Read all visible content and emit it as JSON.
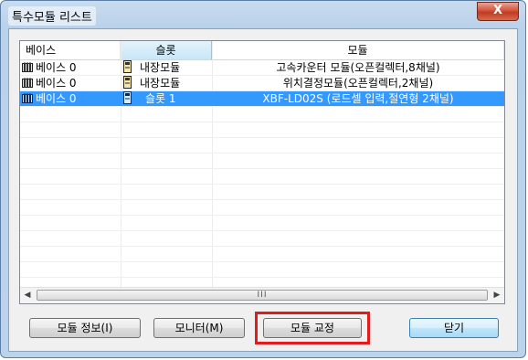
{
  "window": {
    "title": "특수모듈 리스트",
    "close_label": "X"
  },
  "list": {
    "columns": [
      "베이스",
      "슬롯",
      "모듈"
    ],
    "rows": [
      {
        "base": "베이스 0",
        "slot": "내장모듈",
        "module": "고속카운터 모듈(오픈컬렉터,8채널)",
        "selected": false
      },
      {
        "base": "베이스 0",
        "slot": "내장모듈",
        "module": "위치결정모듈(오픈컬렉터,2채널)",
        "selected": false
      },
      {
        "base": "베이스 0",
        "slot": "슬롯 1",
        "module": "XBF-LD02S (로드셀 입력,절연형 2채널)",
        "selected": true
      }
    ],
    "scroll_thumb": "III"
  },
  "buttons": {
    "info": "모듈 정보(I)",
    "monitor": "모니터(M)",
    "calibrate": "모듈 교정",
    "close": "닫기"
  },
  "colors": {
    "selection": "#3399ff",
    "highlight": "#e21b1b"
  },
  "icons": {
    "base": "base-rack-icon",
    "slot": "module-slot-icon"
  }
}
